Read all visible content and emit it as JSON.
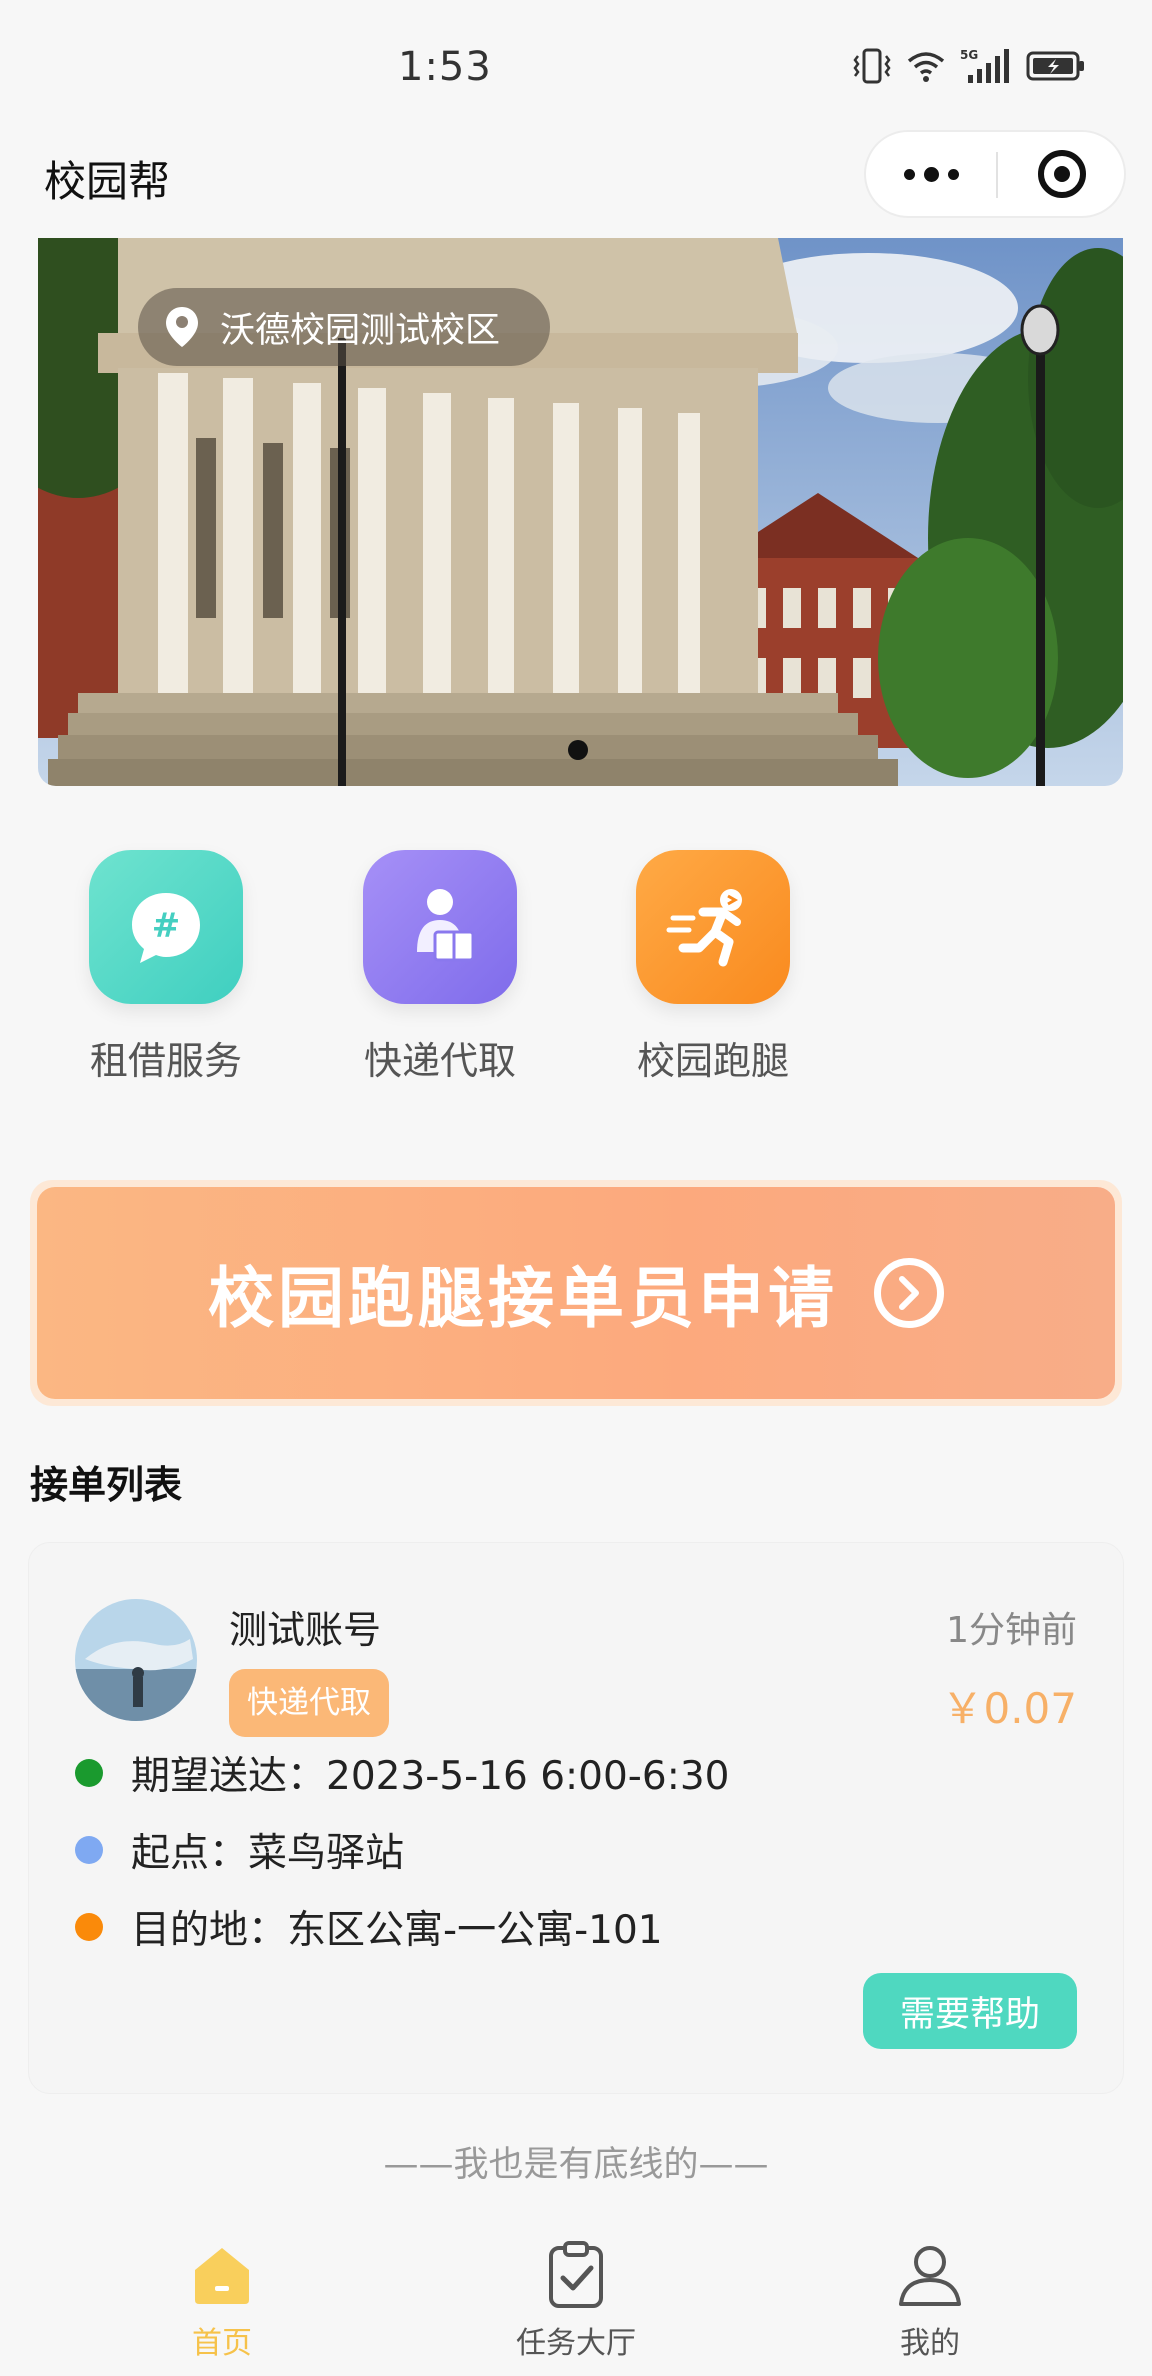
{
  "status_bar": {
    "time": "1:53",
    "network": "5G"
  },
  "app": {
    "title": "校园帮"
  },
  "banner": {
    "location": "沃德校园测试校区",
    "slides_count": 1,
    "active_slide": 1
  },
  "services": [
    {
      "label": "租借服务",
      "icon": "chat-hash-icon",
      "color": "#4fd3c4"
    },
    {
      "label": "快递代取",
      "icon": "package-person-icon",
      "color": "#8f7df0"
    },
    {
      "label": "校园跑腿",
      "icon": "runner-icon",
      "color": "#fa8d2a"
    }
  ],
  "promo": {
    "label": "校园跑腿接单员申请"
  },
  "order_list": {
    "title": "接单列表",
    "orders": [
      {
        "name": "测试账号",
        "type": "快递代取",
        "time_ago": "1分钟前",
        "price": "￥0.07",
        "rows": [
          {
            "text": "期望送达：2023-5-16 6:00-6:30",
            "dot_color": "#1a9a2e"
          },
          {
            "text": "起点：菜鸟驿站",
            "dot_color": "#7fa9f2"
          },
          {
            "text": "目的地：东区公寓-一公寓-101",
            "dot_color": "#fa8a0a"
          }
        ],
        "action": "需要帮助"
      }
    ]
  },
  "footer": {
    "note": "——我也是有底线的——"
  },
  "tabbar": {
    "items": [
      {
        "label": "首页",
        "icon": "home-icon",
        "active": true
      },
      {
        "label": "任务大厅",
        "icon": "clipboard-check-icon",
        "active": false
      },
      {
        "label": "我的",
        "icon": "user-icon",
        "active": false
      }
    ]
  },
  "colors": {
    "accent": "#f6c24a",
    "promo": "#fbb783",
    "help_button": "#4fd8c0",
    "price": "#f7b067"
  }
}
